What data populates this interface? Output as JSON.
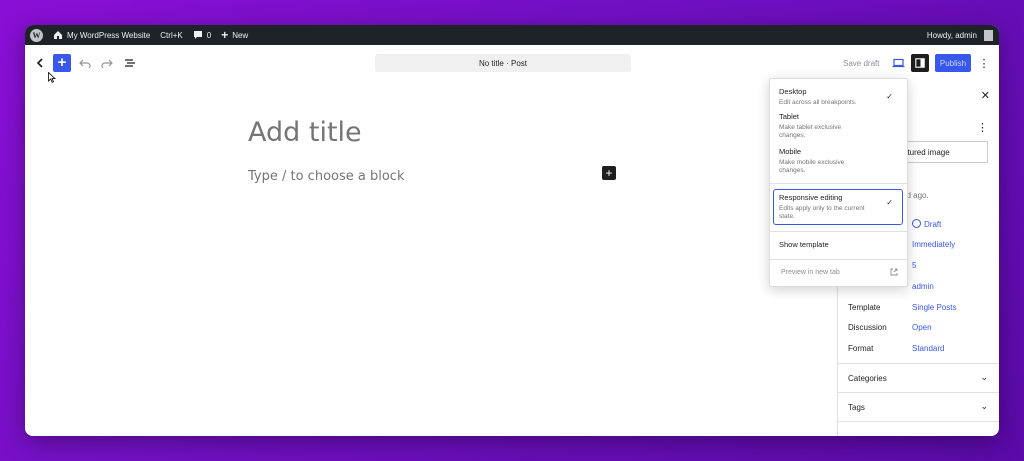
{
  "admin_bar": {
    "site_name": "My WordPress Website",
    "shortcut": "Ctrl+K",
    "comments_count": "0",
    "new_label": "New",
    "howdy": "Howdy, admin"
  },
  "toolbar": {
    "document_title": "No title · Post",
    "save_draft": "Save draft",
    "publish": "Publish"
  },
  "editor": {
    "title_placeholder": "Add title",
    "block_placeholder": "Type / to choose a block"
  },
  "dropdown": {
    "desktop": {
      "label": "Desktop",
      "desc": "Edit across all breakpoints."
    },
    "tablet": {
      "label": "Tablet",
      "desc": "Make tablet exclusive changes."
    },
    "mobile": {
      "label": "Mobile",
      "desc": "Make mobile exclusive changes."
    },
    "responsive": {
      "label": "Responsive editing",
      "desc": "Edits apply only to the current state."
    },
    "show_template": "Show template",
    "preview": "Preview in new tab"
  },
  "sidebar": {
    "featured_image": "atured image",
    "last_edited": "nd ago.",
    "rows": [
      {
        "label": "",
        "value": "Draft"
      },
      {
        "label": "",
        "value": "Immediately"
      },
      {
        "label": "",
        "value": "5"
      },
      {
        "label": "",
        "value": "admin"
      },
      {
        "label": "Template",
        "value": "Single Posts"
      },
      {
        "label": "Discussion",
        "value": "Open"
      },
      {
        "label": "Format",
        "value": "Standard"
      }
    ],
    "panels": {
      "categories": "Categories",
      "tags": "Tags"
    }
  },
  "colors": {
    "accent": "#3858e9",
    "admin_bar": "#1d2327",
    "background": "#7a10cc"
  }
}
